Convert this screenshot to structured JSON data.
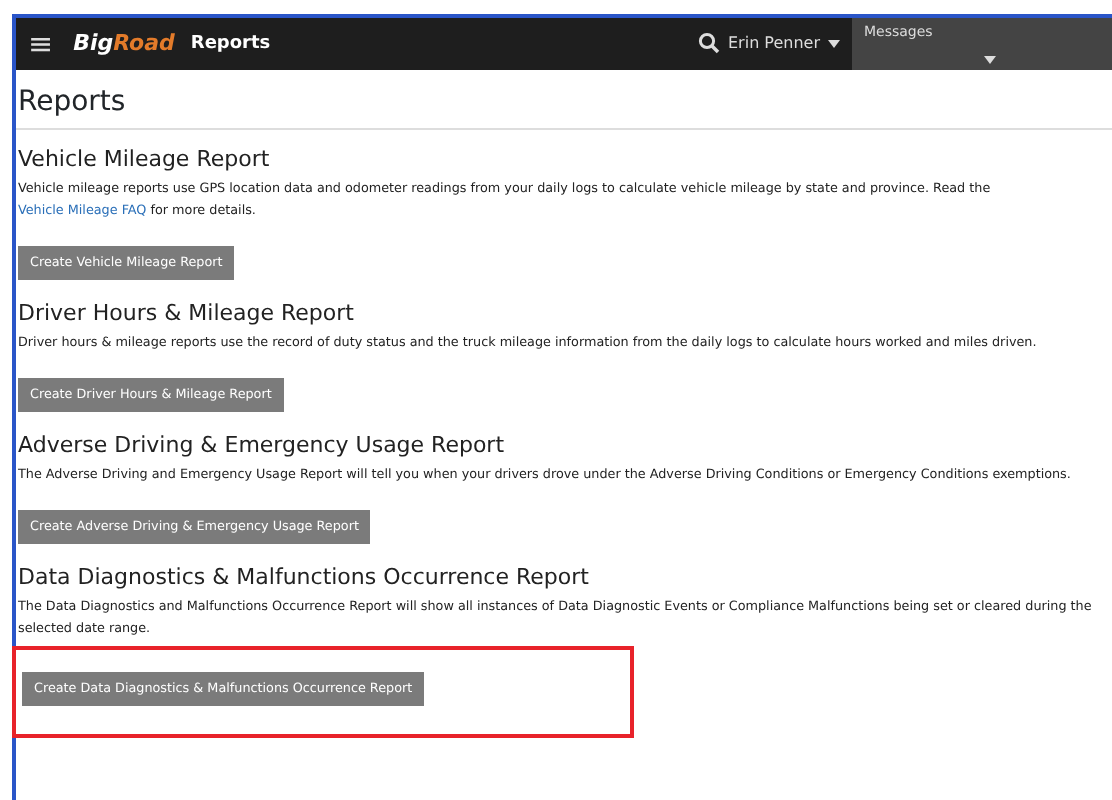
{
  "navbar": {
    "menu_icon": "≡",
    "logo": {
      "word_1": "Big",
      "word_2": "Road"
    },
    "title": "Reports",
    "user": "Erin Penner",
    "messages": "Messages"
  },
  "page_title": "Reports",
  "sections": [
    {
      "heading": "Vehicle Mileage Report",
      "description": "Vehicle mileage reports use GPS location data and odometer readings from your daily logs to calculate vehicle mileage by state and province. Read the",
      "link": "Vehicle Mileage FAQ",
      "description_end": "for more details.",
      "button": "Create Vehicle Mileage Report",
      "highlighted": false
    },
    {
      "heading": "Driver Hours & Mileage Report",
      "description": "Driver hours & mileage reports use the record of duty status and the truck mileage information from the daily logs to calculate hours worked and miles driven.",
      "button": "Create Driver Hours & Mileage Report",
      "highlighted": false
    },
    {
      "heading": "Adverse Driving & Emergency Usage Report",
      "description": "The Adverse Driving and Emergency Usage Report will tell you when your drivers drove under the Adverse Driving Conditions or Emergency Conditions exemptions.",
      "button": "Create Adverse Driving & Emergency Usage Report",
      "highlighted": false
    },
    {
      "heading": "Data Diagnostics & Malfunctions Occurrence Report",
      "description": "The Data Diagnostics and Malfunctions Occurrence Report will show all instances of Data Diagnostic Events or Compliance Malfunctions being set or cleared  during the selected date range.",
      "button": "Create Data Diagnostics & Malfunctions Occurrence Report",
      "highlighted": true
    }
  ]
}
